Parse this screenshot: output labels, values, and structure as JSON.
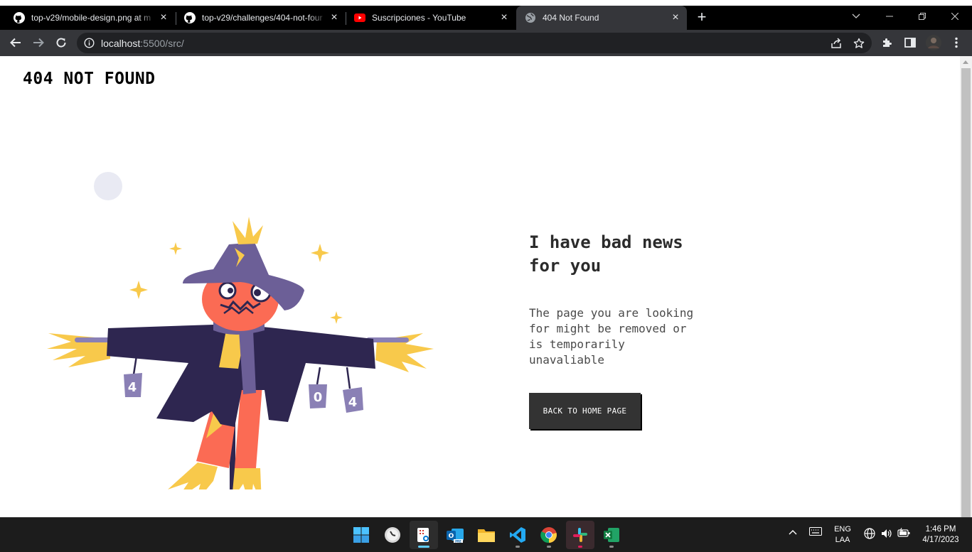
{
  "browser": {
    "tabs": [
      {
        "label": "top-v29/mobile-design.png at m",
        "icon": "github-icon",
        "close": "×"
      },
      {
        "label": "top-v29/challenges/404-not-four",
        "icon": "github-icon",
        "close": "×"
      },
      {
        "label": "Suscripciones - YouTube",
        "icon": "youtube-icon",
        "close": "×"
      },
      {
        "label": "404 Not Found",
        "icon": "globe-icon",
        "close": "×",
        "active": true
      }
    ],
    "new_tab": "+",
    "url_host": "localhost",
    "url_rest": ":5500/src/"
  },
  "page": {
    "title": "404 NOT FOUND",
    "heading": "I have bad news for you",
    "message": "The page you are looking for might be removed or is temporarily unavaliable",
    "button": "BACK TO HOME PAGE",
    "illustration": {
      "can_left": "4",
      "can_middle": "0",
      "can_right": "4"
    }
  },
  "taskbar": {
    "apps": [
      "windows-start-icon",
      "clock-app-icon",
      "snipping-tool-icon",
      "outlook-icon",
      "file-explorer-icon",
      "vscode-icon",
      "chrome-icon",
      "slack-icon",
      "excel-icon"
    ],
    "lang_top": "ENG",
    "lang_bottom": "LAA",
    "time": "1:46 PM",
    "date": "4/17/2023"
  },
  "colors": {
    "tab_bar": "#000000",
    "toolbar": "#35363a",
    "button_bg": "#333333",
    "scarecrow_coat": "#2e2650",
    "scarecrow_hat": "#6c5f97",
    "scarecrow_skin": "#fb6b54",
    "straw": "#f8c94b"
  }
}
